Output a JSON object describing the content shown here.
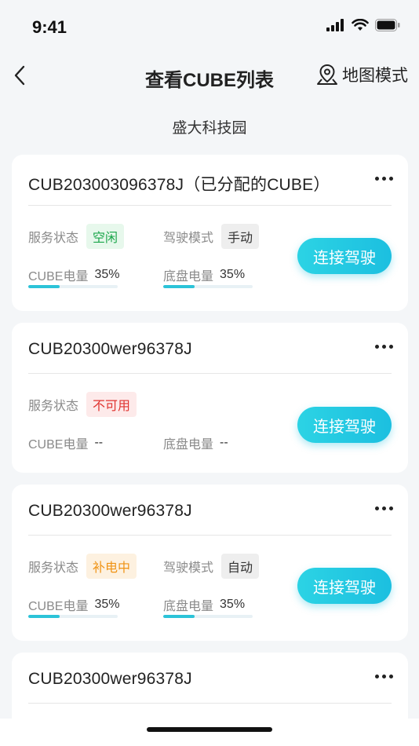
{
  "status_bar": {
    "time": "9:41",
    "icons": [
      "signal-icon",
      "wifi-icon",
      "battery-icon"
    ]
  },
  "nav": {
    "back_icon": "chevron-left-icon",
    "title": "查看CUBE列表",
    "map_mode_label": "地图模式",
    "map_mode_icon": "map-pin-icon"
  },
  "location": "盛大科技园",
  "labels": {
    "service_status": "服务状态",
    "drive_mode": "驾驶模式",
    "cube_power": "CUBE电量",
    "chassis_power": "底盘电量",
    "connect": "连接驾驶"
  },
  "colors": {
    "accent": "#1cbfe0",
    "idle": "#1aa64a",
    "unavailable": "#e0332f",
    "charging": "#f09416"
  },
  "cards": [
    {
      "title": "CUB203003096378J（已分配的CUBE）",
      "status": "空闲",
      "status_color": "green",
      "drive_mode": "手动",
      "cube_power": "35%",
      "cube_power_fraction": 0.35,
      "chassis_power": "35%",
      "chassis_power_fraction": 0.35
    },
    {
      "title": "CUB20300wer96378J",
      "status": "不可用",
      "status_color": "red",
      "cube_power": "--",
      "chassis_power": "--"
    },
    {
      "title": "CUB20300wer96378J",
      "status": "补电中",
      "status_color": "orange",
      "drive_mode": "自动",
      "cube_power": "35%",
      "cube_power_fraction": 0.35,
      "chassis_power": "35%",
      "chassis_power_fraction": 0.35
    },
    {
      "title": "CUB20300wer96378J"
    }
  ]
}
